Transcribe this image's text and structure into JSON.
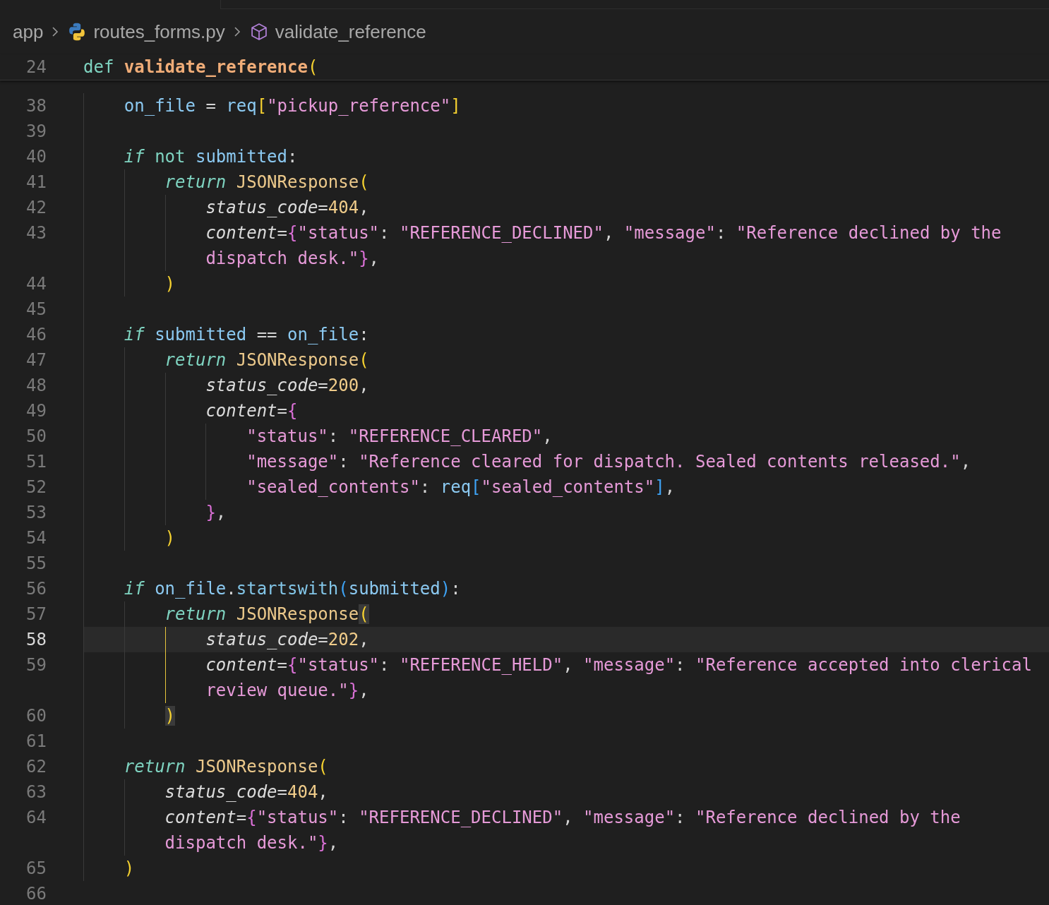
{
  "breadcrumb": [
    {
      "text": "app",
      "kind": "folder"
    },
    {
      "text": "routes_forms.py",
      "kind": "file"
    },
    {
      "text": "validate_reference",
      "kind": "symbol"
    }
  ],
  "sticky_line": {
    "num": "24",
    "tokens": [
      {
        "kind": "kw",
        "text": "def"
      },
      {
        "kind": "fn",
        "text": " validate_reference"
      },
      {
        "kind": "b1",
        "text": "("
      }
    ]
  },
  "lines": [
    {
      "num": "38",
      "tokens": [
        {
          "kind": "var",
          "text": "    on_file"
        },
        {
          "kind": "op",
          "text": " = "
        },
        {
          "kind": "var",
          "text": "req"
        },
        {
          "kind": "b1",
          "text": "["
        },
        {
          "kind": "str",
          "text": "\"pickup_reference\""
        },
        {
          "kind": "b1",
          "text": "]"
        }
      ]
    },
    {
      "num": "39"
    },
    {
      "num": "40",
      "tokens": [
        {
          "kind": "kwi",
          "text": "    if"
        },
        {
          "kind": "kw",
          "text": " not"
        },
        {
          "kind": "var",
          "text": " submitted"
        },
        {
          "kind": "op",
          "text": ":"
        }
      ]
    },
    {
      "num": "41",
      "tokens": [
        {
          "kind": "kwi",
          "text": "        return"
        },
        {
          "kind": "cls",
          "text": " JSONResponse"
        },
        {
          "kind": "b1",
          "text": "("
        }
      ]
    },
    {
      "num": "42",
      "tokens": [
        {
          "kind": "param",
          "text": "            status_code"
        },
        {
          "kind": "op",
          "text": "="
        },
        {
          "kind": "num",
          "text": "404"
        },
        {
          "kind": "op",
          "text": ","
        }
      ]
    },
    {
      "num": "43",
      "tokens": [
        {
          "kind": "param",
          "text": "            content"
        },
        {
          "kind": "op",
          "text": "="
        },
        {
          "kind": "b2",
          "text": "{"
        },
        {
          "kind": "str",
          "text": "\"status\""
        },
        {
          "kind": "op",
          "text": ": "
        },
        {
          "kind": "str",
          "text": "\"REFERENCE_DECLINED\""
        },
        {
          "kind": "op",
          "text": ", "
        },
        {
          "kind": "str",
          "text": "\"message\""
        },
        {
          "kind": "op",
          "text": ": "
        },
        {
          "kind": "str",
          "text": "\"Reference declined by the"
        }
      ],
      "wrap": [
        {
          "kind": "str",
          "text": "dispatch desk.\""
        },
        {
          "kind": "b2",
          "text": "}"
        },
        {
          "kind": "op",
          "text": ","
        }
      ]
    },
    {
      "num": "44",
      "tokens": [
        {
          "kind": "b1",
          "text": "        )"
        }
      ]
    },
    {
      "num": "45"
    },
    {
      "num": "46",
      "tokens": [
        {
          "kind": "kwi",
          "text": "    if"
        },
        {
          "kind": "var",
          "text": " submitted"
        },
        {
          "kind": "op",
          "text": " =="
        },
        {
          "kind": "var",
          "text": " on_file"
        },
        {
          "kind": "op",
          "text": ":"
        }
      ]
    },
    {
      "num": "47",
      "tokens": [
        {
          "kind": "kwi",
          "text": "        return"
        },
        {
          "kind": "cls",
          "text": " JSONResponse"
        },
        {
          "kind": "b1",
          "text": "("
        }
      ]
    },
    {
      "num": "48",
      "tokens": [
        {
          "kind": "param",
          "text": "            status_code"
        },
        {
          "kind": "op",
          "text": "="
        },
        {
          "kind": "num",
          "text": "200"
        },
        {
          "kind": "op",
          "text": ","
        }
      ]
    },
    {
      "num": "49",
      "tokens": [
        {
          "kind": "param",
          "text": "            content"
        },
        {
          "kind": "op",
          "text": "="
        },
        {
          "kind": "b2",
          "text": "{"
        }
      ]
    },
    {
      "num": "50",
      "tokens": [
        {
          "kind": "str",
          "text": "                \"status\""
        },
        {
          "kind": "op",
          "text": ": "
        },
        {
          "kind": "str",
          "text": "\"REFERENCE_CLEARED\""
        },
        {
          "kind": "op",
          "text": ","
        }
      ]
    },
    {
      "num": "51",
      "tokens": [
        {
          "kind": "str",
          "text": "                \"message\""
        },
        {
          "kind": "op",
          "text": ": "
        },
        {
          "kind": "str",
          "text": "\"Reference cleared for dispatch. Sealed contents released.\""
        },
        {
          "kind": "op",
          "text": ","
        }
      ]
    },
    {
      "num": "52",
      "tokens": [
        {
          "kind": "str",
          "text": "                \"sealed_contents\""
        },
        {
          "kind": "op",
          "text": ": "
        },
        {
          "kind": "var",
          "text": "req"
        },
        {
          "kind": "b3",
          "text": "["
        },
        {
          "kind": "str",
          "text": "\"sealed_contents\""
        },
        {
          "kind": "b3",
          "text": "]"
        },
        {
          "kind": "op",
          "text": ","
        }
      ]
    },
    {
      "num": "53",
      "tokens": [
        {
          "kind": "b2",
          "text": "            }"
        },
        {
          "kind": "op",
          "text": ","
        }
      ]
    },
    {
      "num": "54",
      "tokens": [
        {
          "kind": "b1",
          "text": "        )"
        }
      ]
    },
    {
      "num": "55"
    },
    {
      "num": "56",
      "tokens": [
        {
          "kind": "kwi",
          "text": "    if"
        },
        {
          "kind": "var",
          "text": " on_file"
        },
        {
          "kind": "op",
          "text": "."
        },
        {
          "kind": "method",
          "text": "startswith"
        },
        {
          "kind": "b3",
          "text": "("
        },
        {
          "kind": "var",
          "text": "submitted"
        },
        {
          "kind": "b3",
          "text": ")"
        },
        {
          "kind": "op",
          "text": ":"
        }
      ]
    },
    {
      "num": "57",
      "tokens": [
        {
          "kind": "kwi",
          "text": "        return"
        },
        {
          "kind": "cls",
          "text": " JSONResponse"
        },
        {
          "kind": "b1m",
          "text": "("
        }
      ]
    },
    {
      "num": "58",
      "current": true,
      "bracket_guide": true,
      "tokens": [
        {
          "kind": "param",
          "text": "            status_code"
        },
        {
          "kind": "op",
          "text": "="
        },
        {
          "kind": "num",
          "text": "202"
        },
        {
          "kind": "op",
          "text": ","
        }
      ]
    },
    {
      "num": "59",
      "bracket_guide": true,
      "tokens": [
        {
          "kind": "param",
          "text": "            content"
        },
        {
          "kind": "op",
          "text": "="
        },
        {
          "kind": "b2",
          "text": "{"
        },
        {
          "kind": "str",
          "text": "\"status\""
        },
        {
          "kind": "op",
          "text": ": "
        },
        {
          "kind": "str",
          "text": "\"REFERENCE_HELD\""
        },
        {
          "kind": "op",
          "text": ", "
        },
        {
          "kind": "str",
          "text": "\"message\""
        },
        {
          "kind": "op",
          "text": ": "
        },
        {
          "kind": "str",
          "text": "\"Reference accepted into clerical"
        }
      ],
      "wrap": [
        {
          "kind": "str",
          "text": "review queue.\""
        },
        {
          "kind": "b2",
          "text": "}"
        },
        {
          "kind": "op",
          "text": ","
        }
      ]
    },
    {
      "num": "60",
      "tokens": [
        {
          "kind": "b1m",
          "text": "        )"
        }
      ]
    },
    {
      "num": "61"
    },
    {
      "num": "62",
      "tokens": [
        {
          "kind": "kwi",
          "text": "    return"
        },
        {
          "kind": "cls",
          "text": " JSONResponse"
        },
        {
          "kind": "b1",
          "text": "("
        }
      ]
    },
    {
      "num": "63",
      "tokens": [
        {
          "kind": "param",
          "text": "        status_code"
        },
        {
          "kind": "op",
          "text": "="
        },
        {
          "kind": "num",
          "text": "404"
        },
        {
          "kind": "op",
          "text": ","
        }
      ]
    },
    {
      "num": "64",
      "tokens": [
        {
          "kind": "param",
          "text": "        content"
        },
        {
          "kind": "op",
          "text": "="
        },
        {
          "kind": "b2",
          "text": "{"
        },
        {
          "kind": "str",
          "text": "\"status\""
        },
        {
          "kind": "op",
          "text": ": "
        },
        {
          "kind": "str",
          "text": "\"REFERENCE_DECLINED\""
        },
        {
          "kind": "op",
          "text": ", "
        },
        {
          "kind": "str",
          "text": "\"message\""
        },
        {
          "kind": "op",
          "text": ": "
        },
        {
          "kind": "str",
          "text": "\"Reference declined by the"
        }
      ],
      "wrap": [
        {
          "kind": "str",
          "text": "dispatch desk.\""
        },
        {
          "kind": "b2",
          "text": "}"
        },
        {
          "kind": "op",
          "text": ","
        }
      ]
    },
    {
      "num": "65",
      "tokens": [
        {
          "kind": "b1",
          "text": "    )"
        }
      ]
    },
    {
      "num": "66"
    }
  ]
}
